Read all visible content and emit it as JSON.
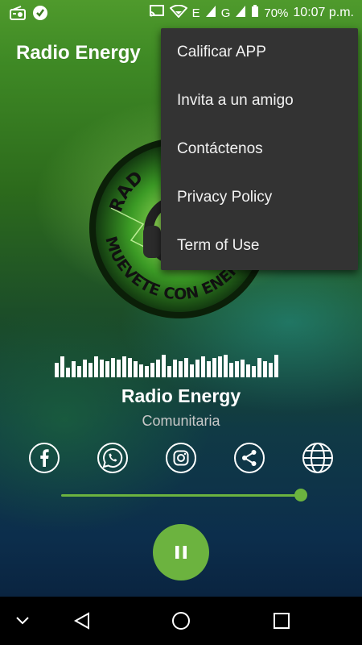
{
  "status_bar": {
    "left_icons": [
      "radio-icon",
      "app-notification-icon"
    ],
    "right_icons": [
      "cast-icon",
      "wifi-icon",
      "signal-icon",
      "battery-icon"
    ],
    "network_e": "E",
    "network_g": "G",
    "battery": "70%",
    "time": "10:07 p.m."
  },
  "app_bar": {
    "title": "Radio Energy"
  },
  "logo": {
    "text_top": "RAD",
    "text_bottom": "MUEVETE CON ENERGIA"
  },
  "menu": {
    "items": [
      {
        "label": "Calificar APP"
      },
      {
        "label": "Invita a un amigo"
      },
      {
        "label": "Contáctenos"
      },
      {
        "label": "Privacy Policy"
      },
      {
        "label": "Term of Use"
      }
    ]
  },
  "player": {
    "station_name": "Radio Energy",
    "genre": "Comunitaria",
    "volume_level": 1.0,
    "state": "playing"
  },
  "social": [
    "facebook-icon",
    "whatsapp-icon",
    "instagram-icon",
    "share-icon",
    "globe-icon"
  ],
  "colors": {
    "accent": "#6cb33f",
    "menu_bg": "#333333",
    "genre_text": "#c8c8c8"
  },
  "nav": [
    "collapse-icon",
    "back-icon",
    "home-icon",
    "recents-icon"
  ]
}
